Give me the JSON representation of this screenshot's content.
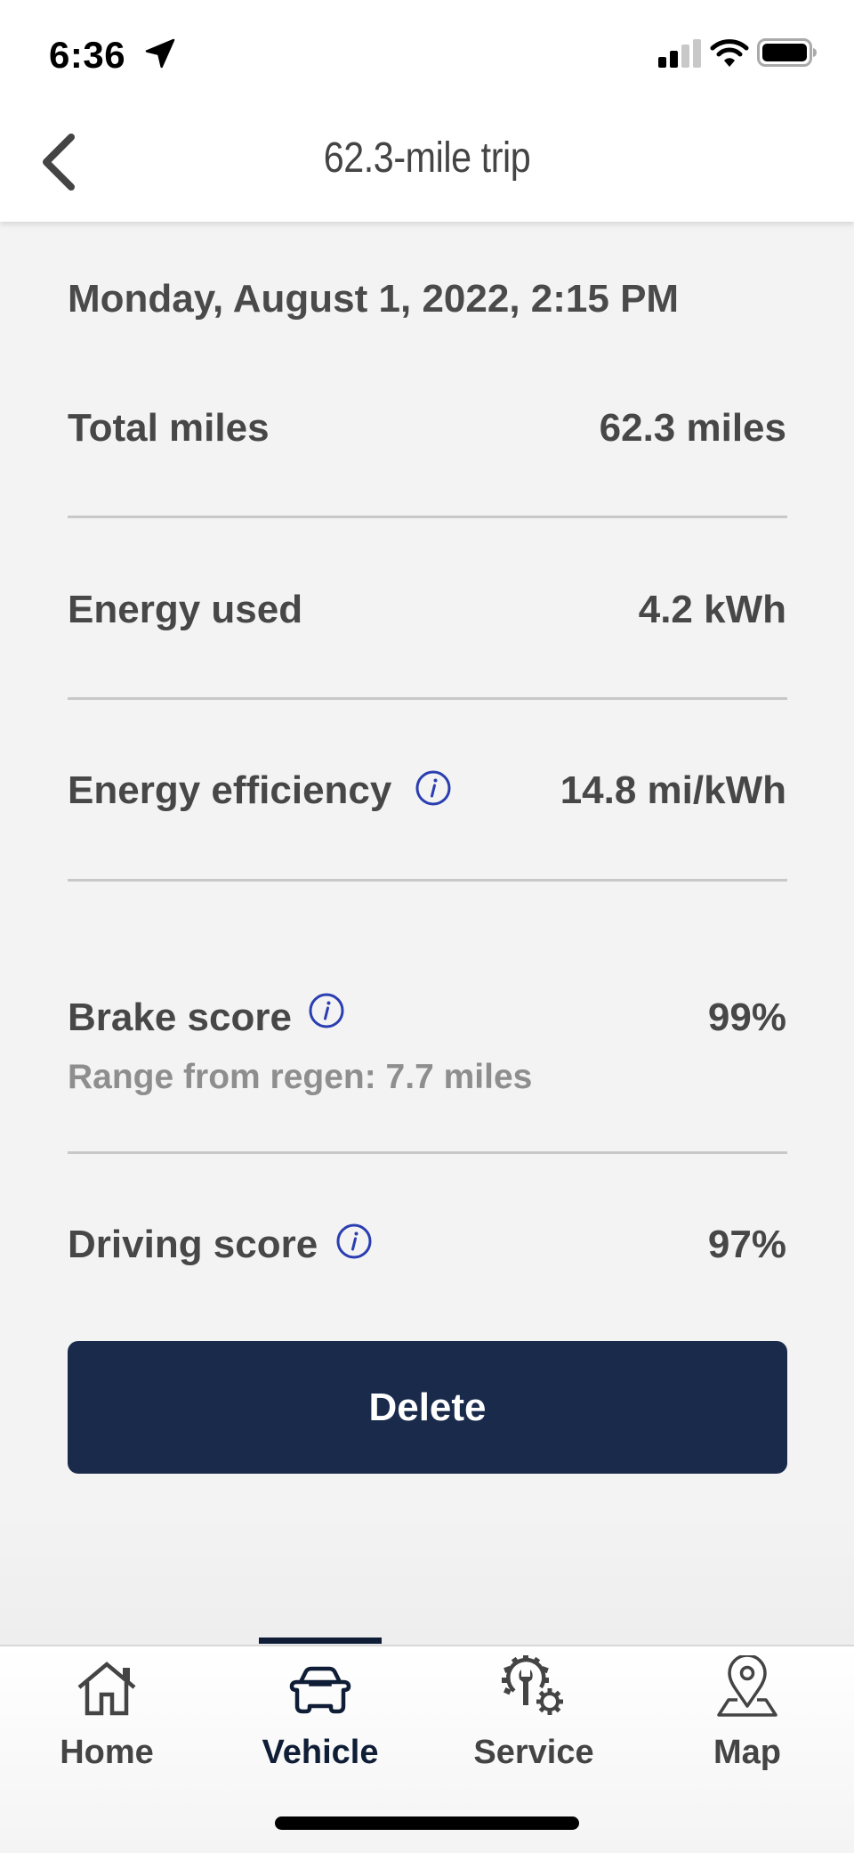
{
  "status_bar": {
    "time": "6:36",
    "icons": [
      "location-arrow-icon",
      "cellular-signal-icon",
      "wifi-icon",
      "battery-icon"
    ]
  },
  "header": {
    "title": "62.3-mile trip",
    "back_icon": "chevron-left-icon"
  },
  "trip": {
    "date": "Monday, August 1, 2022, 2:15 PM",
    "rows": [
      {
        "label": "Total miles",
        "value": "62.3 miles",
        "info": false
      },
      {
        "label": "Energy used",
        "value": "4.2 kWh",
        "info": false
      },
      {
        "label": "Energy efficiency",
        "value": "14.8 mi/kWh",
        "info": true
      },
      {
        "label": "Brake score",
        "value": "99%",
        "info": true,
        "sub": "Range from regen: 7.7 miles"
      },
      {
        "label": "Driving score",
        "value": "97%",
        "info": true
      }
    ]
  },
  "actions": {
    "delete_label": "Delete"
  },
  "tabbar": {
    "active": "Vehicle",
    "items": [
      {
        "label": "Home",
        "icon": "home-icon"
      },
      {
        "label": "Vehicle",
        "icon": "car-icon"
      },
      {
        "label": "Service",
        "icon": "service-gears-icon"
      },
      {
        "label": "Map",
        "icon": "map-pin-icon"
      }
    ]
  },
  "colors": {
    "accent_navy": "#1a2a4b",
    "info_blue": "#2a3eb1",
    "text": "#474747",
    "subtext": "#8e8e8e",
    "background": "#f3f3f3"
  }
}
